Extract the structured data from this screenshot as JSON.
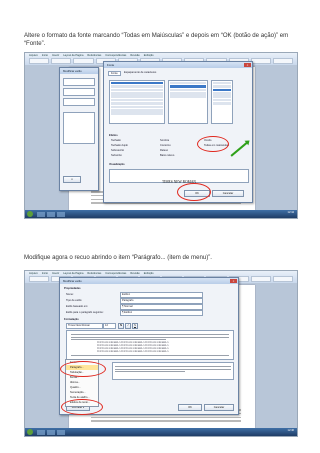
{
  "step1": {
    "text": "Altere o formato da fonte marcando “Todas em Maiúsculas” e depois  em “OK (botão de ação)” em “Fonte”."
  },
  "step2": {
    "text": "Modifique agora o recuo abrindo o item “Parágrafo... (item de menu)”."
  },
  "screenshot1": {
    "ribbon_tabs": [
      "Arquivo",
      "Início",
      "Inserir",
      "Layout da Página",
      "Referências",
      "Correspondências",
      "Revisão",
      "Exibição"
    ],
    "dialog_title": "Fonte",
    "dialog_sub": "Modificar estilo",
    "tabs": [
      "Fonte",
      "Espaçamento de caracteres"
    ],
    "effects_header": "Efeitos",
    "effects": [
      "Tachado",
      "Tachado duplo",
      "Sobrescrito",
      "Subscrito",
      "Sombra",
      "Contorno",
      "Relevo",
      "Baixo relevo",
      "Oculto",
      "Todas em maiúsculas"
    ],
    "preview_label": "Visualização",
    "preview_text": "TIMES NEW ROMAN",
    "ok_label": "OK",
    "cancel_label": "Cancelar",
    "clock": "12:44"
  },
  "screenshot2": {
    "ribbon_tabs": [
      "Arquivo",
      "Início",
      "Inserir",
      "Layout da Página",
      "Referências",
      "Correspondências",
      "Revisão",
      "Exibição"
    ],
    "dialog_title": "Modificar estilo",
    "props_header": "Propriedades",
    "fields": [
      "Nome:",
      "Tipo de estilo:",
      "Estilo baseado em:",
      "Estilo para o parágrafo seguinte:"
    ],
    "field_values": [
      "Estilo1",
      "Parágrafo",
      "¶ Normal",
      "¶ Estilo1"
    ],
    "format_header": "Formatação",
    "font_value": "Times New Roman",
    "size_value": "12",
    "sample_text": "TEXTO DE EXEMPLO TEXTO DE EXEMPLO TEXTO DE EXEMPLO",
    "menu_items": [
      "Fonte...",
      "Parágrafo...",
      "Tabulação...",
      "Borda...",
      "Idioma...",
      "Quadro...",
      "Numeração...",
      "Tecla de atalho...",
      "Efeitos de texto..."
    ],
    "ok_label": "OK",
    "cancel_label": "Cancelar",
    "format_button": "Formatar ▾",
    "clock": "12:46"
  },
  "colors": {
    "highlight_ring": "#e0281f",
    "arrow": "#2fa11a",
    "menu_highlight": "#ffe59a"
  }
}
